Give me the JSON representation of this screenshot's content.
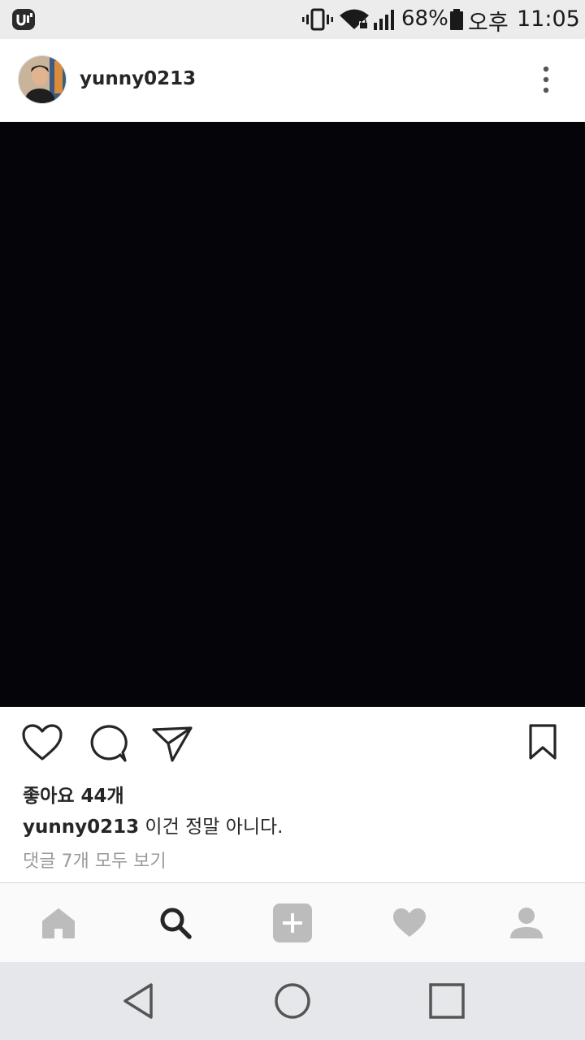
{
  "status_bar": {
    "battery_percent": "68%",
    "ampm": "오후",
    "time": "11:05"
  },
  "post": {
    "username": "yunny0213",
    "likes_text": "좋아요 44개",
    "caption_user": "yunny0213",
    "caption_text": " 이건 정말 아니다.",
    "comments_text": "댓글 7개 모두 보기"
  },
  "icons": {
    "status": [
      "app-logo-icon",
      "vibrate-icon",
      "wifi-icon",
      "signal-icon",
      "battery-icon"
    ],
    "header": [
      "more-options-icon"
    ],
    "actions": [
      "like-heart-icon",
      "comment-icon",
      "share-send-icon",
      "bookmark-icon"
    ],
    "tabs": [
      "home-icon",
      "search-icon",
      "add-post-icon",
      "activity-heart-icon",
      "profile-icon"
    ],
    "navigation": [
      "back-icon",
      "home-circle-icon",
      "recents-icon"
    ]
  },
  "colors": {
    "status_bar_bg": "#ececec",
    "image_bg": "#050509",
    "tab_icon_inactive": "#bcbcbc",
    "tab_icon_active": "#262626",
    "nav_bar_bg": "#e6e7ea",
    "comments_link": "#9a9a9a"
  },
  "tab_bar": {
    "active_tab": "search"
  }
}
